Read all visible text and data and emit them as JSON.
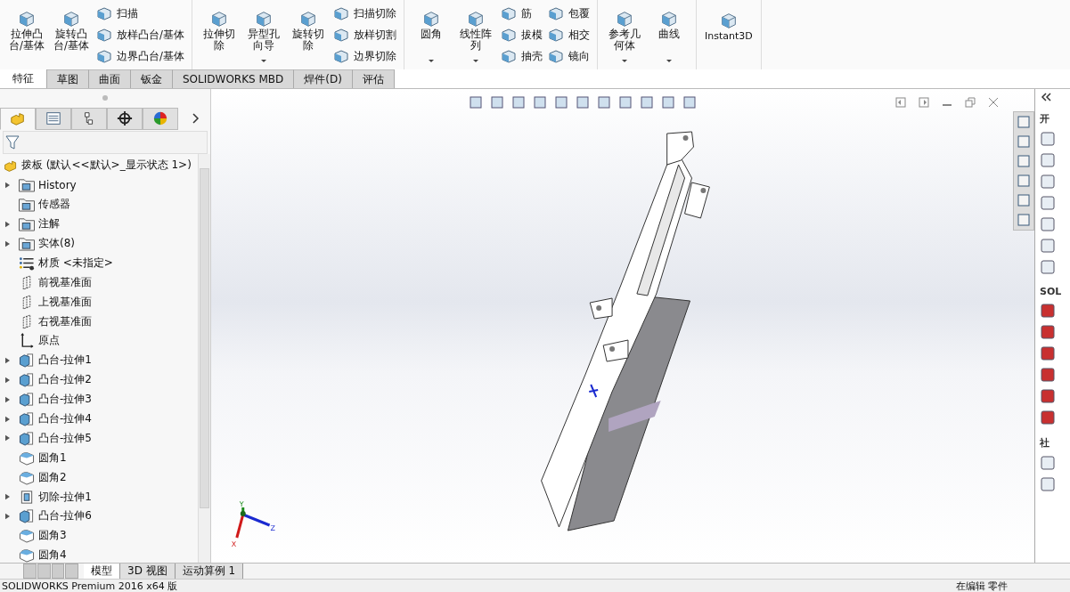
{
  "ribbon": {
    "groups": [
      {
        "items": [
          {
            "label": "拉伸凸台/基体",
            "kind": "large",
            "dropdown": false
          },
          {
            "label": "旋转凸台/基体",
            "kind": "large",
            "dropdown": false
          },
          {
            "label": "扫描",
            "kind": "small"
          },
          {
            "label": "放样凸台/基体",
            "kind": "small"
          },
          {
            "label": "边界凸台/基体",
            "kind": "small"
          }
        ]
      },
      {
        "items": [
          {
            "label": "拉伸切除",
            "kind": "large",
            "dropdown": false
          },
          {
            "label": "异型孔向导",
            "kind": "large",
            "dropdown": true
          },
          {
            "label": "旋转切除",
            "kind": "large",
            "dropdown": false
          },
          {
            "label": "扫描切除",
            "kind": "small"
          },
          {
            "label": "放样切割",
            "kind": "small"
          },
          {
            "label": "边界切除",
            "kind": "small"
          }
        ]
      },
      {
        "items": [
          {
            "label": "圆角",
            "kind": "large",
            "dropdown": true
          },
          {
            "label": "线性阵列",
            "kind": "large",
            "dropdown": true
          },
          {
            "label": "筋",
            "kind": "small"
          },
          {
            "label": "拔模",
            "kind": "small"
          },
          {
            "label": "抽壳",
            "kind": "small"
          },
          {
            "label": "包覆",
            "kind": "small"
          },
          {
            "label": "相交",
            "kind": "small"
          },
          {
            "label": "镜向",
            "kind": "small"
          }
        ]
      },
      {
        "items": [
          {
            "label": "参考几何体",
            "kind": "large",
            "dropdown": true
          },
          {
            "label": "曲线",
            "kind": "large",
            "dropdown": true
          }
        ]
      },
      {
        "items": [
          {
            "label": "Instant3D",
            "kind": "wide",
            "dropdown": false
          }
        ]
      }
    ]
  },
  "tabs": [
    {
      "label": "特征",
      "selected": true
    },
    {
      "label": "草图",
      "selected": false
    },
    {
      "label": "曲面",
      "selected": false
    },
    {
      "label": "钣金",
      "selected": false
    },
    {
      "label": "SOLIDWORKS MBD",
      "selected": false
    },
    {
      "label": "焊件(D)",
      "selected": false
    },
    {
      "label": "评估",
      "selected": false
    }
  ],
  "panel_tabs": [
    {
      "selected": true
    },
    {
      "selected": false
    },
    {
      "selected": false
    },
    {
      "selected": false
    },
    {
      "selected": false
    }
  ],
  "tree": {
    "root": "拨板 (默认<<默认>_显示状态 1>)",
    "items": [
      {
        "label": "History",
        "kind": "folder",
        "expandable": true
      },
      {
        "label": "传感器",
        "kind": "folder",
        "expandable": false
      },
      {
        "label": "注解",
        "kind": "folder",
        "expandable": true
      },
      {
        "label": "实体(8)",
        "kind": "folder",
        "expandable": true
      },
      {
        "label": "材质 <未指定>",
        "kind": "material",
        "expandable": false
      },
      {
        "label": "前视基准面",
        "kind": "plane",
        "expandable": false
      },
      {
        "label": "上视基准面",
        "kind": "plane",
        "expandable": false
      },
      {
        "label": "右视基准面",
        "kind": "plane",
        "expandable": false
      },
      {
        "label": "原点",
        "kind": "origin",
        "expandable": false
      },
      {
        "label": "凸台-拉伸1",
        "kind": "boss",
        "expandable": true
      },
      {
        "label": "凸台-拉伸2",
        "kind": "boss",
        "expandable": true
      },
      {
        "label": "凸台-拉伸3",
        "kind": "boss",
        "expandable": true
      },
      {
        "label": "凸台-拉伸4",
        "kind": "boss",
        "expandable": true
      },
      {
        "label": "凸台-拉伸5",
        "kind": "boss",
        "expandable": true
      },
      {
        "label": "圆角1",
        "kind": "fillet",
        "expandable": false
      },
      {
        "label": "圆角2",
        "kind": "fillet",
        "expandable": false
      },
      {
        "label": "切除-拉伸1",
        "kind": "cut",
        "expandable": true
      },
      {
        "label": "凸台-拉伸6",
        "kind": "boss",
        "expandable": true
      },
      {
        "label": "圆角3",
        "kind": "fillet",
        "expandable": false
      },
      {
        "label": "圆角4",
        "kind": "fillet",
        "expandable": false
      }
    ]
  },
  "triad": [
    "Y",
    "Z",
    "X"
  ],
  "task_pane": {
    "sections": [
      "开",
      "SOL",
      "社"
    ]
  },
  "bottom_tabs": [
    {
      "label": "模型",
      "selected": true
    },
    {
      "label": "3D 视图",
      "selected": false
    },
    {
      "label": "运动算例 1",
      "selected": false
    }
  ],
  "status_bar": {
    "left": "SOLIDWORKS Premium 2016 x64 版",
    "right": "在编辑 零件"
  }
}
